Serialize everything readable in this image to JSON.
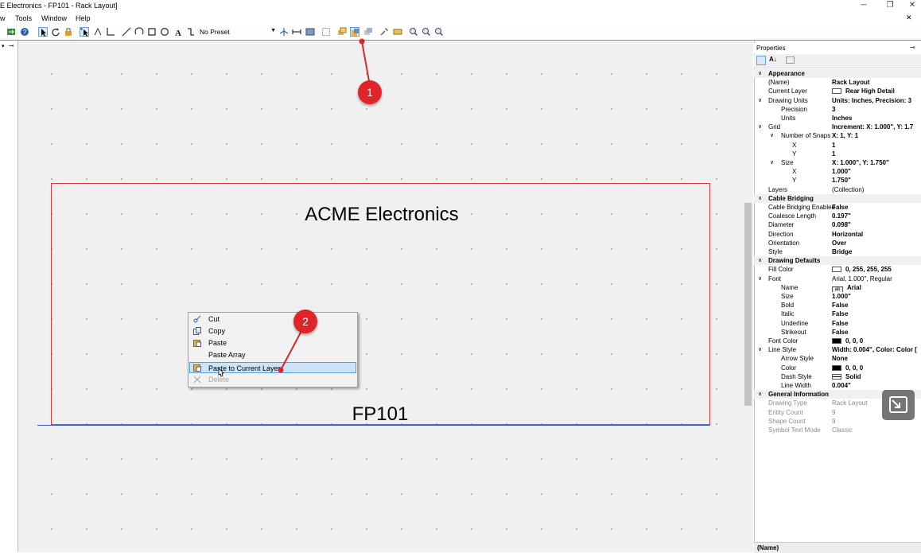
{
  "window": {
    "title": "E Electronics - FP101 - Rack Layout]",
    "controls": [
      "─",
      "❐",
      "✕"
    ],
    "mdi_controls": [
      "✕"
    ]
  },
  "menu": {
    "items": [
      "w",
      "Tools",
      "Window",
      "Help"
    ]
  },
  "toolbar": {
    "preset": "No Preset",
    "icons": [
      "export-icon",
      "help-icon",
      "select-pointer-icon",
      "rotate-icon",
      "paint-icon",
      "node-select-icon",
      "node-edit-icon",
      "dimension-icon",
      "line-icon",
      "arc-icon",
      "rectangle-icon",
      "circle-icon",
      "text-tool-icon",
      "connector-icon",
      "preset-dropdown",
      "snap-icon",
      "measure-icon",
      "image-icon",
      "group-icon",
      "layer-copy-icon",
      "paste-to-layer-icon",
      "layer-move-icon",
      "wrench-icon",
      "ruler-icon",
      "zoom-out-icon",
      "zoom-in-icon",
      "zoom-icon"
    ]
  },
  "canvas": {
    "heading": "ACME Electronics",
    "label": "FP101"
  },
  "context_menu": {
    "items": [
      {
        "label": "Cut",
        "icon": "scissors-icon",
        "state": "normal"
      },
      {
        "label": "Copy",
        "icon": "copy-icon",
        "state": "normal"
      },
      {
        "label": "Paste",
        "icon": "clipboard-icon",
        "state": "normal"
      },
      {
        "label": "Paste Array",
        "icon": "",
        "state": "normal"
      },
      {
        "label": "Paste to Current Layer",
        "icon": "clipboard-icon",
        "state": "highlighted"
      },
      {
        "label": "Delete",
        "icon": "delete-x-icon",
        "state": "disabled"
      }
    ]
  },
  "callouts": [
    "1",
    "2"
  ],
  "properties": {
    "title": "Properties",
    "pin": "📌",
    "rows": [
      {
        "type": "cat",
        "key": "Appearance"
      },
      {
        "key": "(Name)",
        "value": "Rack Layout",
        "indent": 0
      },
      {
        "key": "Current Layer",
        "value": "Rear High Detail",
        "indent": 0,
        "swatch": "#ffffff"
      },
      {
        "key": "Drawing Units",
        "value": "Units: Inches, Precision: 3",
        "indent": 0,
        "toggle": "v"
      },
      {
        "key": "Precision",
        "value": "3",
        "indent": 1
      },
      {
        "key": "Units",
        "value": "Inches",
        "indent": 1
      },
      {
        "key": "Grid",
        "value": "Increment: X: 1.000\", Y: 1.7",
        "indent": 0,
        "toggle": "v"
      },
      {
        "key": "Number of Snaps",
        "value": "X: 1, Y: 1",
        "indent": 1,
        "toggle": "v"
      },
      {
        "key": "X",
        "value": "1",
        "indent": 2
      },
      {
        "key": "Y",
        "value": "1",
        "indent": 2
      },
      {
        "key": "Size",
        "value": "X: 1.000\", Y: 1.750\"",
        "indent": 1,
        "toggle": "v"
      },
      {
        "key": "X",
        "value": "1.000\"",
        "indent": 2
      },
      {
        "key": "Y",
        "value": "1.750\"",
        "indent": 2
      },
      {
        "key": "Layers",
        "value": "(Collection)",
        "indent": 0,
        "norm": true
      },
      {
        "type": "cat",
        "key": "Cable Bridging"
      },
      {
        "key": "Cable Bridging Enabled",
        "value": "False",
        "indent": 0
      },
      {
        "key": "Coalesce Length",
        "value": "0.197\"",
        "indent": 0
      },
      {
        "key": "Diameter",
        "value": "0.098\"",
        "indent": 0
      },
      {
        "key": "Direction",
        "value": "Horizontal",
        "indent": 0
      },
      {
        "key": "Orientation",
        "value": "Over",
        "indent": 0
      },
      {
        "key": "Style",
        "value": "Bridge",
        "indent": 0
      },
      {
        "type": "cat",
        "key": "Drawing Defaults"
      },
      {
        "key": "Fill Color",
        "value": "0, 255, 255, 255",
        "indent": 0,
        "swatch": "#ffffff"
      },
      {
        "key": "Font",
        "value": "Arial, 1.000\", Regular",
        "indent": 0,
        "toggle": "v",
        "norm": true
      },
      {
        "key": "Name",
        "value": "Arial",
        "indent": 1,
        "swatch": "#e8e8e8",
        "swatch_text": "ab"
      },
      {
        "key": "Size",
        "value": "1.000\"",
        "indent": 1
      },
      {
        "key": "Bold",
        "value": "False",
        "indent": 1
      },
      {
        "key": "Italic",
        "value": "False",
        "indent": 1
      },
      {
        "key": "Underline",
        "value": "False",
        "indent": 1
      },
      {
        "key": "Strikeout",
        "value": "False",
        "indent": 1
      },
      {
        "key": "Font Color",
        "value": "0, 0, 0",
        "indent": 0,
        "swatch": "#000000"
      },
      {
        "key": "Line Style",
        "value": "Width: 0.004\", Color: Color [",
        "indent": 0,
        "toggle": "v"
      },
      {
        "key": "Arrow Style",
        "value": "None",
        "indent": 1
      },
      {
        "key": "Color",
        "value": "0, 0, 0",
        "indent": 1,
        "swatch": "#000000"
      },
      {
        "key": "Dash Style",
        "value": "Solid",
        "indent": 1,
        "swatch": "#ffffff",
        "swatch_line": true
      },
      {
        "key": "Line Width",
        "value": "0.004\"",
        "indent": 1
      },
      {
        "type": "cat",
        "key": "General Information"
      },
      {
        "key": "Drawing Type",
        "value": "Rack Layout",
        "indent": 0,
        "grey": true
      },
      {
        "key": "Entity Count",
        "value": "9",
        "indent": 0,
        "grey": true
      },
      {
        "key": "Shape Count",
        "value": "9",
        "indent": 0,
        "grey": true
      },
      {
        "key": "Symbol Text Mode",
        "value": "Classic",
        "indent": 0,
        "grey": true
      }
    ],
    "footer": "(Name)"
  },
  "colors": {
    "accent_red": "#e0242a",
    "selection": "#cce4f7",
    "frame": "#d73a3a"
  }
}
